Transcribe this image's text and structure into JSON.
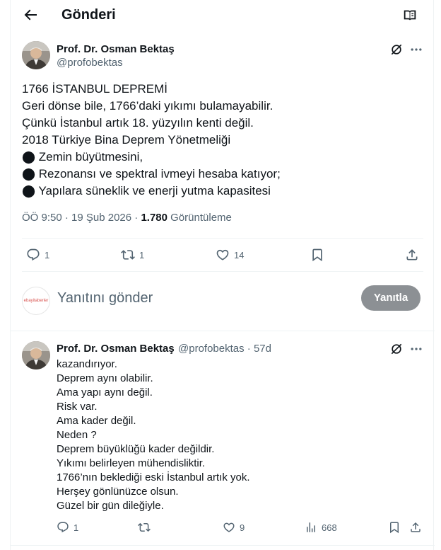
{
  "header": {
    "title": "Gönderi"
  },
  "main_post": {
    "author_name": "Prof. Dr. Osman Bektaş",
    "handle": "@profobektas",
    "lines": [
      "1766 İSTANBUL DEPREMİ",
      "Geri dönse bile, 1766’daki yıkımı bulamayabilir.",
      "Çünkü İstanbul artık 18. yüzyılın kenti değil.",
      "2018 Türkiye Bina Deprem Yönetmeliği",
      "⬤ Zemin büyütmesini,",
      "⬤ Rezonansı ve spektral ivmeyi hesaba katıyor;",
      "⬤ Yapılara süneklik ve enerji yutma kapasitesi"
    ],
    "time": "ÖÖ 9:50 · 19 Şub 2026 ·",
    "views_count": "1.780",
    "views_label": "Görüntüleme",
    "reply_count": "1",
    "repost_count": "1",
    "like_count": "14"
  },
  "reply_composer": {
    "avatar_text": "ebayitaberler",
    "placeholder": "Yanıtını gönder",
    "button_label": "Yanıtla"
  },
  "reply_post": {
    "author_name": "Prof. Dr. Osman Bektaş",
    "handle": "@profobektas",
    "age": "· 57d",
    "lines": [
      "kazandırıyor.",
      "Deprem aynı olabilir.",
      "Ama yapı aynı değil.",
      "Risk var.",
      "Ama kader değil.",
      "Neden ?",
      "Deprem büyüklüğü kader değildir.",
      "Yıkımı belirleyen mühendisliktir.",
      "1766’nın beklediği eski İstanbul artık yok.",
      "Herşey gönlünüzce olsun.",
      "Güzel bir gün dileğiyle."
    ],
    "reply_count": "1",
    "like_count": "9",
    "views_count": "668"
  },
  "colors": {
    "text": "#0f1419",
    "secondary": "#536471",
    "divider": "#eff3f4",
    "reply_button": "#8c9094"
  },
  "icons": [
    "back-arrow-icon",
    "reader-icon",
    "grok-icon",
    "more-icon",
    "reply-icon",
    "repost-icon",
    "like-icon",
    "bookmark-icon",
    "share-icon",
    "views-icon"
  ]
}
